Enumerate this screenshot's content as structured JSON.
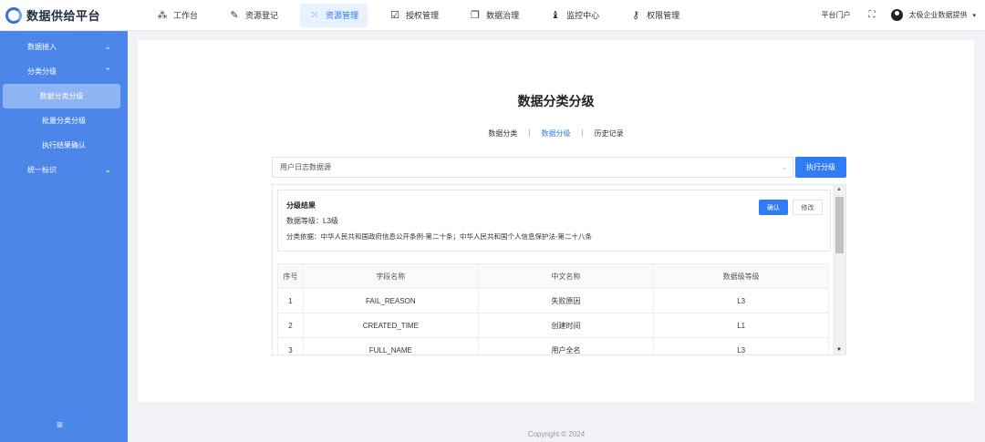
{
  "app": {
    "title": "数据供给平台"
  },
  "nav": [
    {
      "label": "工作台",
      "icon": "workbench-icon",
      "glyph": "⁂"
    },
    {
      "label": "资源登记",
      "icon": "pen-icon",
      "glyph": "✎"
    },
    {
      "label": "资源管理",
      "icon": "grid-icon",
      "glyph": "⁙",
      "active": true
    },
    {
      "label": "授权管理",
      "icon": "check-box-icon",
      "glyph": "☑"
    },
    {
      "label": "数据治理",
      "icon": "copy-icon",
      "glyph": "❐"
    },
    {
      "label": "监控中心",
      "icon": "bell-icon",
      "glyph": "♝"
    },
    {
      "label": "权限管理",
      "icon": "key-icon",
      "glyph": "⚷"
    }
  ],
  "header_right": {
    "portal": "平台门户",
    "fullscreen_glyph": "⛶",
    "user": "太极企业数据提供",
    "caret": "▾"
  },
  "sidebar": {
    "groups": [
      {
        "label": "数据接入",
        "chevron": "⌄"
      },
      {
        "label": "分类分级",
        "chevron": "⌃"
      }
    ],
    "sub_items": [
      "数据分类分级",
      "批量分类分级",
      "执行结果确认"
    ],
    "group3": {
      "label": "统一标识",
      "chevron": "⌄"
    },
    "collapse_glyph": "≡"
  },
  "page": {
    "title": "数据分类分级",
    "tabs": [
      "数据分类",
      "数据分级",
      "历史记录"
    ],
    "tab_sep": "|",
    "select_value": "用户日志数据源",
    "select_arrow": "⌄",
    "exec_button": "执行分级"
  },
  "result": {
    "title": "分级结果",
    "level_line": "数据等级：L3级",
    "basis_line": "分类依据：中华人民共和国政府信息公开条例-第二十条；中华人民共和国个人信息保护法-第二十八条",
    "confirm_button": "确认",
    "edit_button": "修改"
  },
  "table": {
    "headers": [
      "序号",
      "字段名称",
      "中文名称",
      "数据级等级"
    ],
    "rows": [
      [
        "1",
        "FAIL_REASON",
        "失败原因",
        "L3"
      ],
      [
        "2",
        "CREATED_TIME",
        "创建时间",
        "L1"
      ],
      [
        "3",
        "FULL_NAME",
        "用户全名",
        "L3"
      ]
    ]
  },
  "scrollbar": {
    "up": "▲",
    "down": "▼"
  },
  "footer": "Copyright © 2024",
  "colors": {
    "primary": "#2f7cf6",
    "sidebar": "#4c86e8"
  }
}
